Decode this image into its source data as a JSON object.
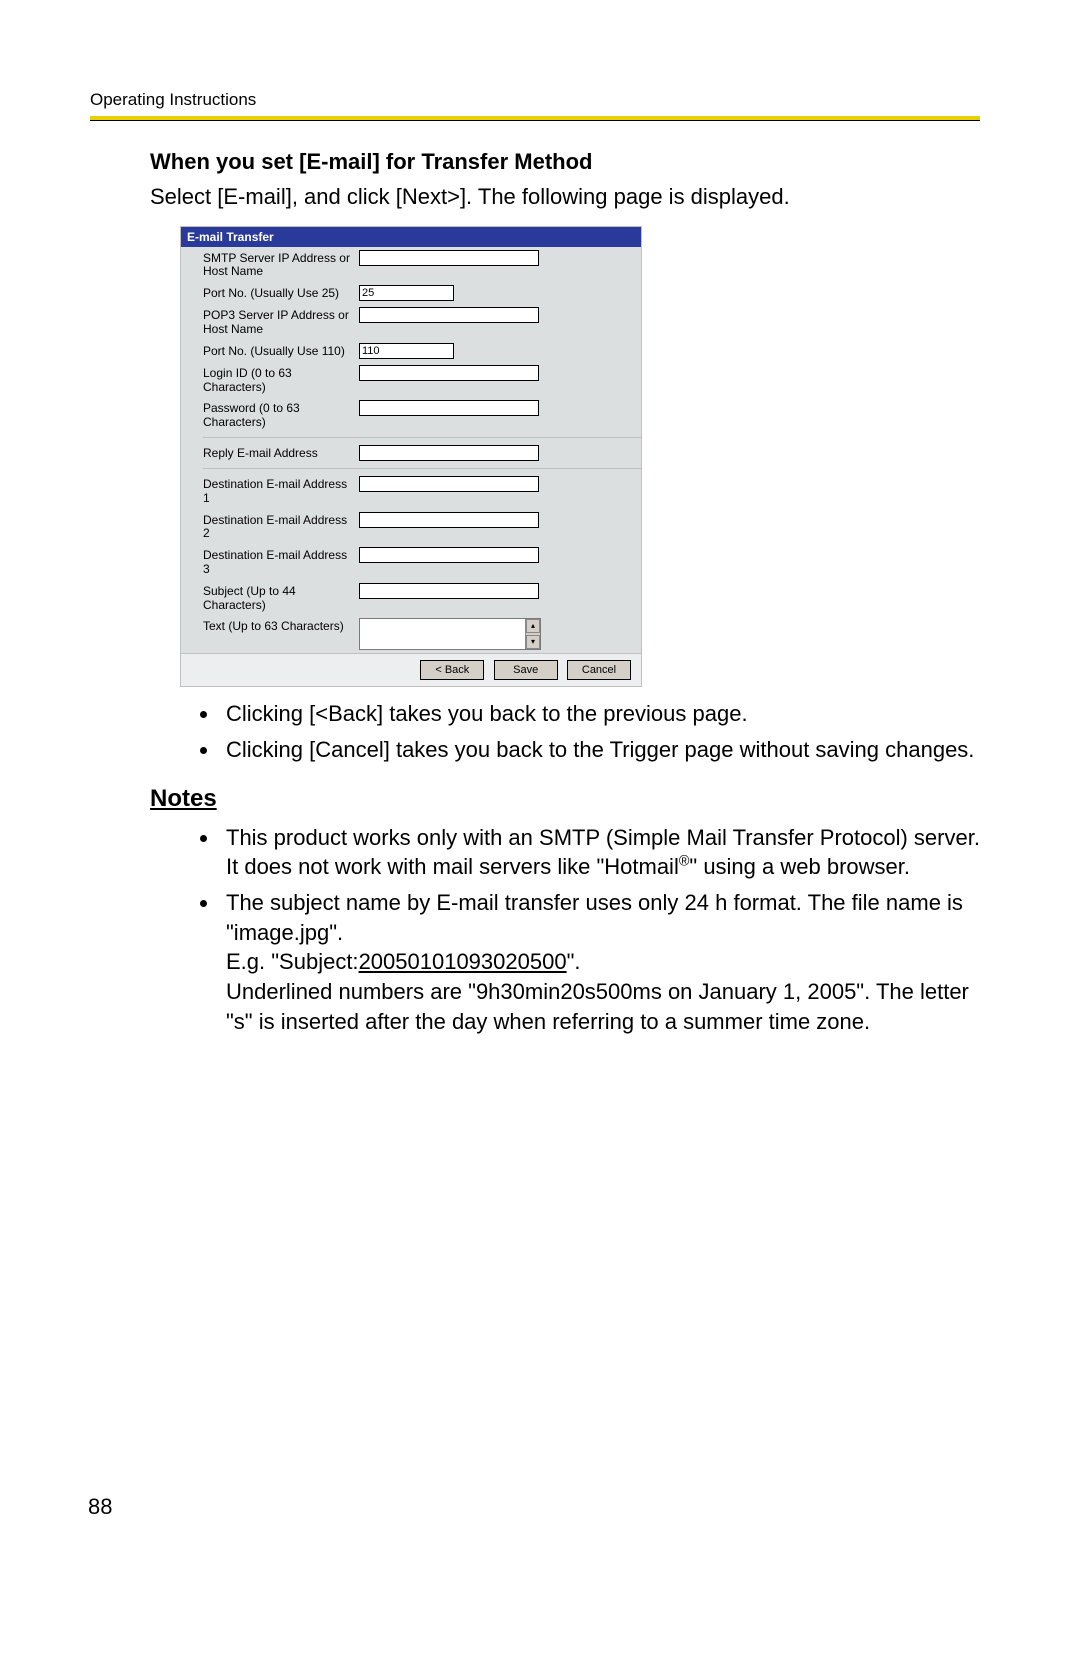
{
  "running_head": "Operating Instructions",
  "section_title": "When you set [E-mail] for Transfer Method",
  "intro_text": "Select [E-mail], and click [Next>]. The following page is displayed.",
  "form": {
    "title": "E-mail Transfer",
    "fields": [
      {
        "label": "SMTP Server IP Address or Host Name",
        "value": "",
        "long": true
      },
      {
        "label": "Port No. (Usually Use 25)",
        "value": "25",
        "long": false
      },
      {
        "label": "POP3 Server IP Address or Host Name",
        "value": "",
        "long": true
      },
      {
        "label": "Port No. (Usually Use 110)",
        "value": "110",
        "long": false
      },
      {
        "label": "Login ID (0 to 63 Characters)",
        "value": "",
        "long": true
      },
      {
        "label": "Password (0 to 63 Characters)",
        "value": "",
        "long": true
      }
    ],
    "fields2": [
      {
        "label": "Reply E-mail Address",
        "value": "",
        "long": true
      }
    ],
    "fields3": [
      {
        "label": "Destination E-mail Address 1",
        "value": "",
        "long": true
      },
      {
        "label": "Destination E-mail Address 2",
        "value": "",
        "long": true
      },
      {
        "label": "Destination E-mail Address 3",
        "value": "",
        "long": true
      },
      {
        "label": "Subject (Up to 44 Characters)",
        "value": "",
        "long": true
      }
    ],
    "textarea_label": "Text (Up to 63 Characters)",
    "buttons": {
      "back": "< Back",
      "save": "Save",
      "cancel": "Cancel"
    }
  },
  "bullets_after": [
    "Clicking [<Back] takes you back to the previous page.",
    "Clicking [Cancel] takes you back to the Trigger page without saving changes."
  ],
  "notes_heading": "Notes",
  "note1": "This product works only with an SMTP (Simple Mail Transfer Protocol) server. It does not work with mail servers like \"Hotmail",
  "note1_tm": "®",
  "note1_tail": "\" using a web browser.",
  "note2_a": "The subject name by E-mail transfer uses only 24 h format. The file name is \"image.jpg\".",
  "note2_b_prefix": "E.g. \"Subject:",
  "note2_b_underlined": "20050101093020500",
  "note2_b_suffix": "\".",
  "note2_c": "Underlined numbers are \"9h30min20s500ms on January 1, 2005\". The letter \"s\" is inserted after the day when referring to a summer time zone.",
  "page_number": "88"
}
